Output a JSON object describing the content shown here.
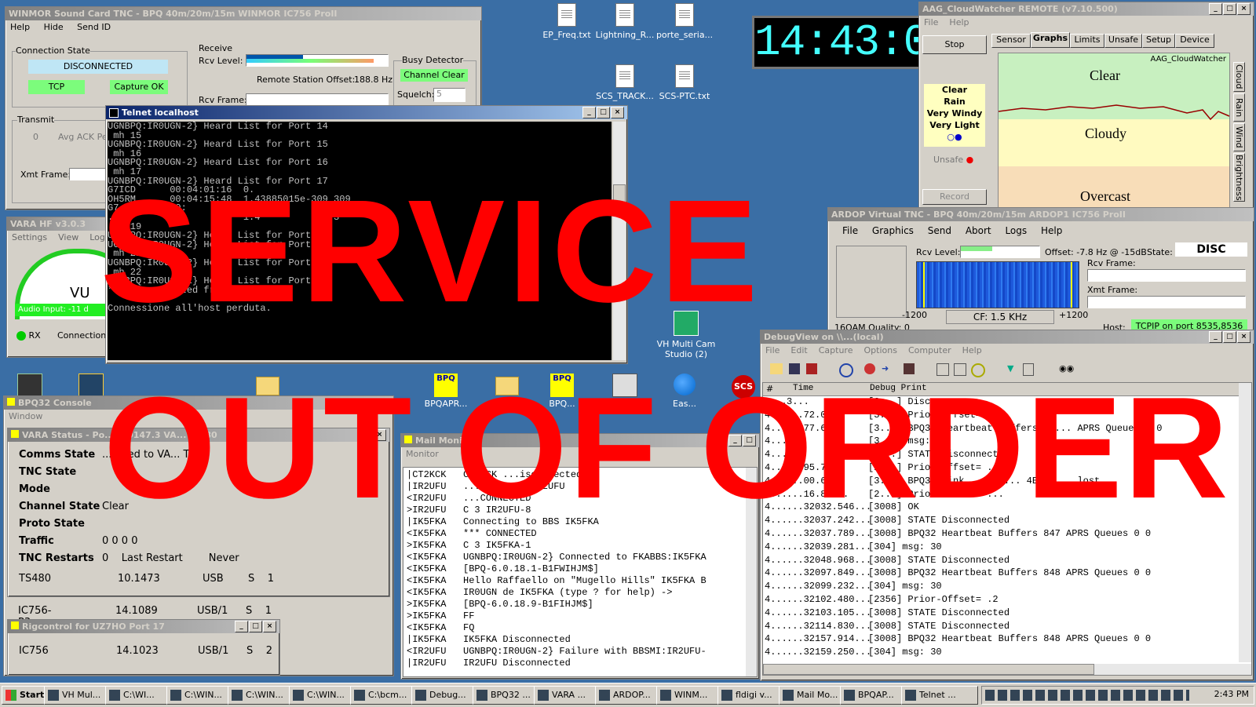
{
  "desktop_icons": [
    {
      "label": "EP_Freq.txt"
    },
    {
      "label": "Lightning_R..."
    },
    {
      "label": "porte_seria..."
    },
    {
      "label": "SCS_TRACK..."
    },
    {
      "label": "SCS-PTC.txt"
    },
    {
      "label": "VH Multi Cam Studio (2)"
    },
    {
      "label": "BPQAPR..."
    },
    {
      "label": "...ig"
    },
    {
      "label": "BPQ..."
    },
    {
      "label": "...pq_co..."
    },
    {
      "label": "Eas..."
    }
  ],
  "clock": {
    "time": "14:43:00"
  },
  "winmor": {
    "title": "WINMOR Sound Card TNC - BPQ 40m/20m/15m WINMOR IC756 ProII",
    "menu": [
      "Help",
      "Hide",
      "Send ID"
    ],
    "conn_state_label": "Connection State",
    "state": "DISCONNECTED",
    "tcp": "TCP",
    "capture": "Capture OK",
    "receive_label": "Receive",
    "rcv_level": "Rcv Level:",
    "offset_label": "Remote Station Offset:",
    "offset_value": "188.8 Hz",
    "rcv_frame": "Rcv Frame:",
    "busy_label": "Busy Detector",
    "channel": "Channel Clear",
    "squelch_label": "Squelch:",
    "squelch_value": "5",
    "transmit": "Transmit",
    "avg_ack": "Avg ACK Per",
    "zero": "0",
    "xmt_frame": "Xmt Frame:"
  },
  "telnet": {
    "title": "Telnet localhost",
    "lines": [
      "UGNBPQ:IR0UGN-2} Heard List for Port 14",
      " mh 15",
      "UGNBPQ:IR0UGN-2} Heard List for Port 15",
      " mh 16",
      "UGNBPQ:IR0UGN-2} Heard List for Port 16",
      " mh 17",
      "UGNBPQ:IR0UGN-2} Heard List for Port 17",
      "G7ICD      00:04:01:16  0.",
      "OH5RM      00:04:15:48  1.43885015e-309 309",
      "G7...      00:          1.4         324 3",
      "...        00:          1.4             3",
      " mh 19",
      "UGNBPQ:IR0UGN-2} Heard List for Port 19",
      "UGNBPQ:IR0UGN-2} Heard List for Port 20",
      " mh 21",
      "UGNBPQ:IR0UGN-2} Heard List for Port 21",
      " mh 22",
      "UGNBPQ:IR0UGN-2} Heard List for Port 22",
      "*** Disconnected from Stream 1",
      "",
      "Connessione all'host perduta."
    ]
  },
  "cloudwatcher": {
    "title": "AAG_CloudWatcher REMOTE (v7.10.500)",
    "menu": [
      "File",
      "Help"
    ],
    "stop": "Stop",
    "tabs": [
      "Sensor",
      "Graphs",
      "Limits",
      "Unsafe",
      "Setup",
      "Device"
    ],
    "conditions": [
      "Clear",
      "Rain",
      "Very Windy",
      "Very Light"
    ],
    "unsafe": "Unsafe",
    "record": "Record",
    "brand": "AAG_CloudWatcher",
    "bands": [
      "Clear",
      "Cloudy",
      "Overcast"
    ],
    "side_tabs": [
      "Cloud",
      "Rain",
      "Wind",
      "Brightness"
    ]
  },
  "ardop": {
    "title": "ARDOP Virtual TNC - BPQ 40m/20m/15m ARDOP1 IC756 ProII",
    "menu": [
      "File",
      "Graphics",
      "Send",
      "Abort",
      "Logs",
      "Help"
    ],
    "rcv_level": "Rcv Level:",
    "offset": "Offset: -7.8 Hz @ -15dB",
    "state_label": "State:",
    "state": "DISC",
    "rcv_frame": "Rcv Frame:",
    "xmt_frame": "Xmt Frame:",
    "quality": "16QAM Quality: 0",
    "f_low": "-1200",
    "cf": "CF: 1.5 KHz",
    "f_high": "+1200",
    "host_label": "Host:",
    "host": "TCPIP on port 8535,8536"
  },
  "vara_hf": {
    "title": "VARA HF v3.0.3",
    "menu": [
      "Settings",
      "View",
      "Log*"
    ],
    "vu": "VU",
    "audio": "Audio Input: -11 d",
    "rx": "RX",
    "conn": "Connection"
  },
  "debugview": {
    "title": "DebugView on \\\\...(local)",
    "menu": [
      "File",
      "Edit",
      "Capture",
      "Options",
      "Computer",
      "Help"
    ],
    "col_num": "#",
    "col_time": "Time",
    "col_print": "Debug Print",
    "rows": [
      {
        "n": "4...",
        "t": "3...",
        "p": "[3...]  Disconn..."
      },
      {
        "n": "4...",
        "t": "...72.0...",
        "p": "[3...]  Prior-Offset= .4"
      },
      {
        "n": "4...",
        "t": "...77.6...",
        "p": "[3...]  BPQ32 Heartbeat Buffers 84... APRS Queues 0 0"
      },
      {
        "n": "4...",
        "t": "...",
        "p": "[3...]  msg: 30"
      },
      {
        "n": "4...",
        "t": "...",
        "p": "[3...]  STATE Disconnected"
      },
      {
        "n": "4...",
        "t": "...95.7...",
        "p": "[2...]  Prior-Offset= ..."
      },
      {
        "n": "4...",
        "t": "...00.6...",
        "p": "[3...]  BPQ32 Link ...our... 4EGV-... lost"
      },
      {
        "n": "4...",
        "t": "...16.81...",
        "p": "[2...]  Prior-Offset= ..."
      },
      {
        "n": "4...",
        "t": "...32032.546...",
        "p": "[3008] OK"
      },
      {
        "n": "4...",
        "t": "...32037.242...",
        "p": "[3008] STATE Disconnected"
      },
      {
        "n": "4...",
        "t": "...32037.789...",
        "p": "[3008] BPQ32 Heartbeat Buffers 847 APRS Queues 0 0"
      },
      {
        "n": "4...",
        "t": "...32039.281...",
        "p": "[304] msg: 30"
      },
      {
        "n": "4...",
        "t": "...32048.968...",
        "p": "[3008] STATE Disconnected"
      },
      {
        "n": "4...",
        "t": "...32097.849...",
        "p": "[3008] BPQ32 Heartbeat Buffers 848 APRS Queues 0 0"
      },
      {
        "n": "4...",
        "t": "...32099.232...",
        "p": "[304] msg: 30"
      },
      {
        "n": "4...",
        "t": "...32102.480...",
        "p": "[2356] Prior-Offset= .2"
      },
      {
        "n": "4...",
        "t": "...32103.105...",
        "p": "[3008] STATE Disconnected"
      },
      {
        "n": "4...",
        "t": "...32114.830...",
        "p": "[3008] STATE Disconnected"
      },
      {
        "n": "4...",
        "t": "...32157.914...",
        "p": "[3008] BPQ32 Heartbeat Buffers 848 APRS Queues 0 0"
      },
      {
        "n": "4...",
        "t": "...32159.250...",
        "p": "[304] msg: 30"
      }
    ]
  },
  "bpq_console": {
    "title": "BPQ32 Console",
    "menu": "Window"
  },
  "vara_status": {
    "title": "VARA Status - Po... ...0147.3 VA... ...480",
    "rows": [
      {
        "k": "Comms State",
        "v": "...ected to VA... TNC"
      },
      {
        "k": "TNC State",
        "v": ""
      },
      {
        "k": "Mode",
        "v": ""
      },
      {
        "k": "Channel State",
        "v": "Clear"
      },
      {
        "k": "Proto State",
        "v": ""
      },
      {
        "k": "Traffic",
        "v": "0 0 0 0"
      },
      {
        "k": "TNC Restarts",
        "v": "0    Last Restart        Never"
      }
    ],
    "ts_name": "TS480",
    "ts_freq": "10.1473",
    "ts_mode": "USB",
    "ts_s": "S    1"
  },
  "rig_ic756p3": {
    "name": "IC756-P3",
    "freq": "14.1089",
    "mode": "USB/1",
    "s": "S    1"
  },
  "rigcontrol": {
    "title": "Rigcontrol for UZ7HO Port 17",
    "name": "IC756",
    "freq": "14.1023",
    "mode": "USB/1",
    "s": "S    2"
  },
  "mail_monitor": {
    "title": "Mail Monitor",
    "menu": "Monitor",
    "lines": [
      "|CT2KCK   CT2KCK ...isconnected",
      "|IR2UFU   ...ing to   IR2UFU",
      "<IR2UFU   ...CONNECTED",
      ">IR2UFU   C 3 IR2UFU-8",
      "|IK5FKA   Connecting to BBS IK5FKA",
      "<IK5FKA   *** CONNECTED",
      ">IK5FKA   C 3 IK5FKA-1",
      "<IK5FKA   UGNBPQ:IR0UGN-2} Connected to FKABBS:IK5FKA",
      "<IK5FKA   [BPQ-6.0.18.1-B1FWIHJM$]",
      "<IK5FKA   Hello Raffaello on \"Mugello Hills\" IK5FKA B",
      "<IK5FKA   IR0UGN de IK5FKA (type ? for help) ->",
      ">IK5FKA   [BPQ-6.0.18.9-B1FIHJM$]",
      ">IK5FKA   FF",
      "<IK5FKA   FQ",
      "|IK5FKA   IK5FKA Disconnected",
      "<IR2UFU   UGNBPQ:IR0UGN-2} Failure with BBSMI:IR2UFU-",
      "|IR2UFU   IR2UFU Disconnected"
    ]
  },
  "overlay": {
    "line1": "SERVICE",
    "line2": "OUT OF ORDER"
  },
  "taskbar": {
    "start": "Start",
    "items": [
      "VH Mul...",
      "C:\\WI...",
      "C:\\WIN...",
      "C:\\WIN...",
      "C:\\WIN...",
      "C:\\bcm...",
      "Debug...",
      "BPQ32 ...",
      "VARA ...",
      "ARDOP...",
      "WINM...",
      "fldigi v...",
      "Mail Mo...",
      "BPQAP...",
      "Telnet ..."
    ],
    "time": "2:43 PM"
  }
}
